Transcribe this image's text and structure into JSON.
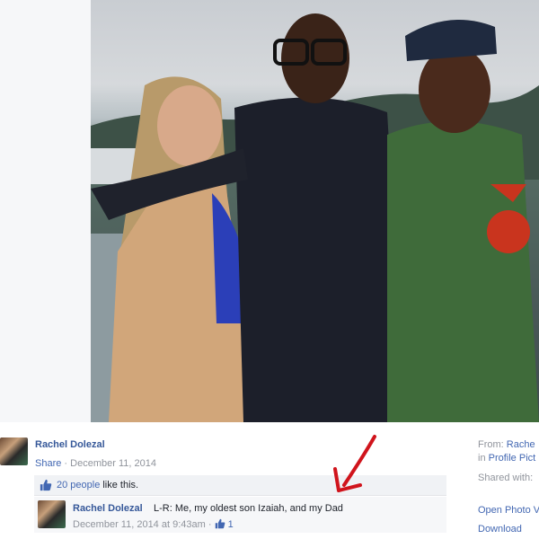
{
  "post": {
    "poster_name": "Rachel Dolezal",
    "share_label": "Share",
    "separator": "·",
    "date": "December 11, 2014"
  },
  "likes": {
    "count_text": "20 people",
    "suffix_text": "like this."
  },
  "comment": {
    "author": "Rachel Dolezal",
    "text": "L-R: Me, my oldest son Izaiah, and my Dad",
    "timestamp": "December 11, 2014 at 9:43am",
    "meta_sep": "·",
    "like_count": "1"
  },
  "sidebar": {
    "from_label": "From:",
    "from_name": "Rache",
    "in_prefix": "in",
    "album": "Profile Pict",
    "shared_with": "Shared with:",
    "open_photo": "Open Photo V",
    "download": "Download"
  },
  "colors": {
    "link_blue": "#4267b2",
    "name_blue": "#365899",
    "arrow_red": "#d0141c"
  },
  "icons": {
    "like": "thumbs-up-icon",
    "annotation": "red-arrow"
  }
}
